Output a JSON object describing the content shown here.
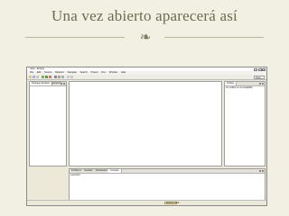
{
  "slide": {
    "title": "Una vez abierto aparecerá así",
    "ornament_icon": "fleuron-icon"
  },
  "window": {
    "title": "Java - Eclipse",
    "menu": [
      "File",
      "Edit",
      "Source",
      "Refactor",
      "Navigate",
      "Search",
      "Project",
      "Run",
      "Window",
      "Help"
    ],
    "perspective_label": "Java",
    "package_explorer_tab": "Package Explorer",
    "hierarchy_tab": "Hierarchy",
    "outline_tab": "Outline",
    "outline_message": "An outline is not available.",
    "bottom_tabs": [
      "Problems",
      "Javadoc",
      "Declaration",
      "Console"
    ],
    "console_message": "Launcher",
    "status_text": "Eclipse Web"
  },
  "colors": {
    "slide_background": "#f2f0e2",
    "title_color": "#6b6b52",
    "window_chrome": "#ece9d8"
  }
}
